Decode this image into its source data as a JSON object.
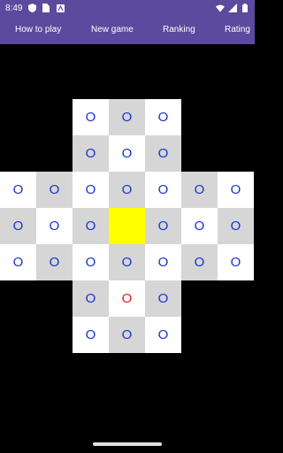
{
  "status_bar": {
    "time": "8:49",
    "left_icons": [
      "shield-icon",
      "sim-icon",
      "accessibility-icon"
    ],
    "right_icons": [
      "wifi-icon",
      "signal-icon",
      "battery-icon"
    ]
  },
  "menu": {
    "items": [
      {
        "label": "How to play"
      },
      {
        "label": "New game"
      },
      {
        "label": "Ranking"
      },
      {
        "label": "Rating"
      }
    ]
  },
  "board": {
    "piece_symbol": "O",
    "colors": {
      "piece": "#1a33cc",
      "selected_piece": "#e01b1b",
      "empty_hole": "#ffff00",
      "cell_light": "#ffffff",
      "cell_dark": "#d6d6d6",
      "background": "#000000"
    },
    "rows": [
      "..OOO..",
      "..OOO..",
      "OOOOOOO",
      "OOO_OOO",
      "OOOOOOO",
      "..ORO..",
      "..OOO.."
    ]
  }
}
